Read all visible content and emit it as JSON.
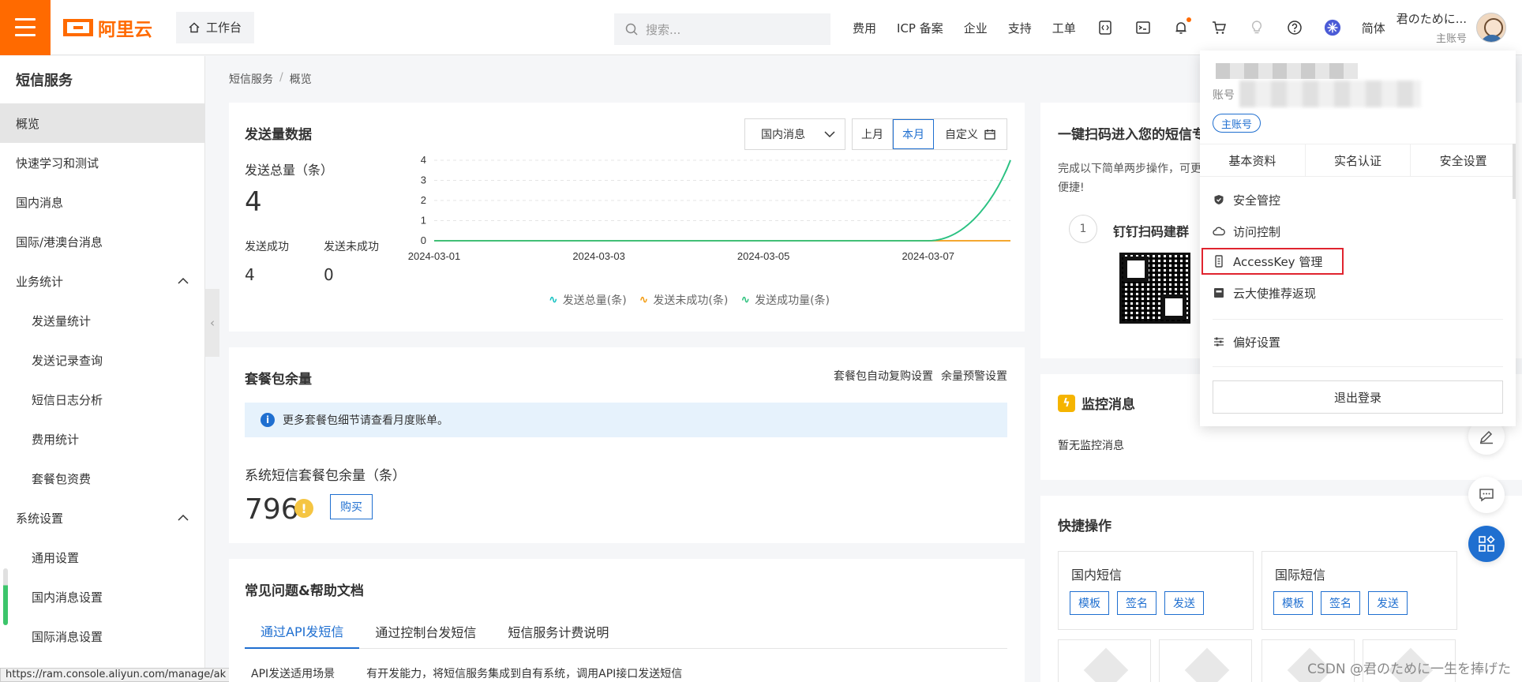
{
  "header": {
    "logo_text": "阿里云",
    "workbench_label": "工作台",
    "search_placeholder": "搜索...",
    "nav": [
      "费用",
      "ICP 备案",
      "企业",
      "支持",
      "工单"
    ],
    "language": "简体",
    "user_name": "君のために...",
    "user_role": "主账号",
    "accent_color": "#ff6a00"
  },
  "sidebar": {
    "title": "短信服务",
    "items": [
      {
        "label": "概览",
        "active": true
      },
      {
        "label": "快速学习和测试"
      },
      {
        "label": "国内消息"
      },
      {
        "label": "国际/港澳台消息"
      },
      {
        "label": "业务统计",
        "expandable": true
      },
      {
        "label": "发送量统计",
        "sub": true
      },
      {
        "label": "发送记录查询",
        "sub": true
      },
      {
        "label": "短信日志分析",
        "sub": true
      },
      {
        "label": "费用统计",
        "sub": true
      },
      {
        "label": "套餐包资费",
        "sub": true
      },
      {
        "label": "系统设置",
        "expandable": true
      },
      {
        "label": "通用设置",
        "sub": true
      },
      {
        "label": "国内消息设置",
        "sub": true
      },
      {
        "label": "国际消息设置",
        "sub": true
      }
    ]
  },
  "status_url": "https://ram.console.aliyun.com/manage/ak",
  "breadcrumb": [
    "短信服务",
    "概览"
  ],
  "send_stats": {
    "title": "发送量数据",
    "select_value": "国内消息",
    "range_options": [
      "上月",
      "本月",
      "自定义"
    ],
    "total_label": "发送总量（条）",
    "total_value": "4",
    "success_label": "发送成功",
    "success_value": "4",
    "fail_label": "发送未成功",
    "fail_value": "0"
  },
  "chart_data": {
    "type": "line",
    "x": [
      "2024-03-01",
      "2024-03-02",
      "2024-03-03",
      "2024-03-04",
      "2024-03-05",
      "2024-03-06",
      "2024-03-07",
      "2024-03-08"
    ],
    "x_ticks": [
      "2024-03-01",
      "2024-03-03",
      "2024-03-05",
      "2024-03-07"
    ],
    "ylim": [
      0,
      4
    ],
    "y_ticks": [
      0,
      1,
      2,
      3,
      4
    ],
    "series": [
      {
        "name": "发送总量(条)",
        "values": [
          0,
          0,
          0,
          0,
          0,
          0,
          0,
          4
        ],
        "color": "#16c2c2"
      },
      {
        "name": "发送未成功(条)",
        "values": [
          0,
          0,
          0,
          0,
          0,
          0,
          0,
          0
        ],
        "color": "#f39c12"
      },
      {
        "name": "发送成功量(条)",
        "values": [
          0,
          0,
          0,
          0,
          0,
          0,
          0,
          4
        ],
        "color": "#2ec27e"
      }
    ],
    "grid": true,
    "legend_position": "bottom"
  },
  "package": {
    "title": "套餐包余量",
    "links": [
      "套餐包自动复购设置",
      "余量预警设置"
    ],
    "info": "更多套餐包细节请查看月度账单。",
    "remain_label": "系统短信套餐包余量（条）",
    "remain_value": "796",
    "buy_label": "购买"
  },
  "faq": {
    "title": "常见问题&帮助文档",
    "tabs": [
      "通过API发短信",
      "通过控制台发短信",
      "短信服务计费说明"
    ],
    "row_label": "API发送适用场景",
    "row_text": "有开发能力，将短信服务集成到自有系统，调用API接口发送短信"
  },
  "scan": {
    "title": "一键扫码进入您的短信专",
    "desc": "完成以下简单两步操作，可更便捷!",
    "step_no": "1",
    "step_title": "钉钉扫码建群"
  },
  "monitor": {
    "title": "监控消息",
    "empty": "暂无监控消息"
  },
  "quick": {
    "title": "快捷操作",
    "boxes": [
      {
        "title": "国内短信",
        "buttons": [
          "模板",
          "签名",
          "发送"
        ]
      },
      {
        "title": "国际短信",
        "buttons": [
          "模板",
          "签名",
          "发送"
        ]
      }
    ]
  },
  "dropdown": {
    "account_label": "账号",
    "badge": "主账号",
    "tabs": [
      "基本资料",
      "实名认证",
      "安全设置"
    ],
    "items": [
      "安全管控",
      "访问控制",
      "AccessKey 管理",
      "云大使推荐返现",
      "偏好设置"
    ],
    "logout": "退出登录",
    "highlight_color": "#e0242f"
  },
  "watermark": "CSDN @君のために一生を捧げた"
}
